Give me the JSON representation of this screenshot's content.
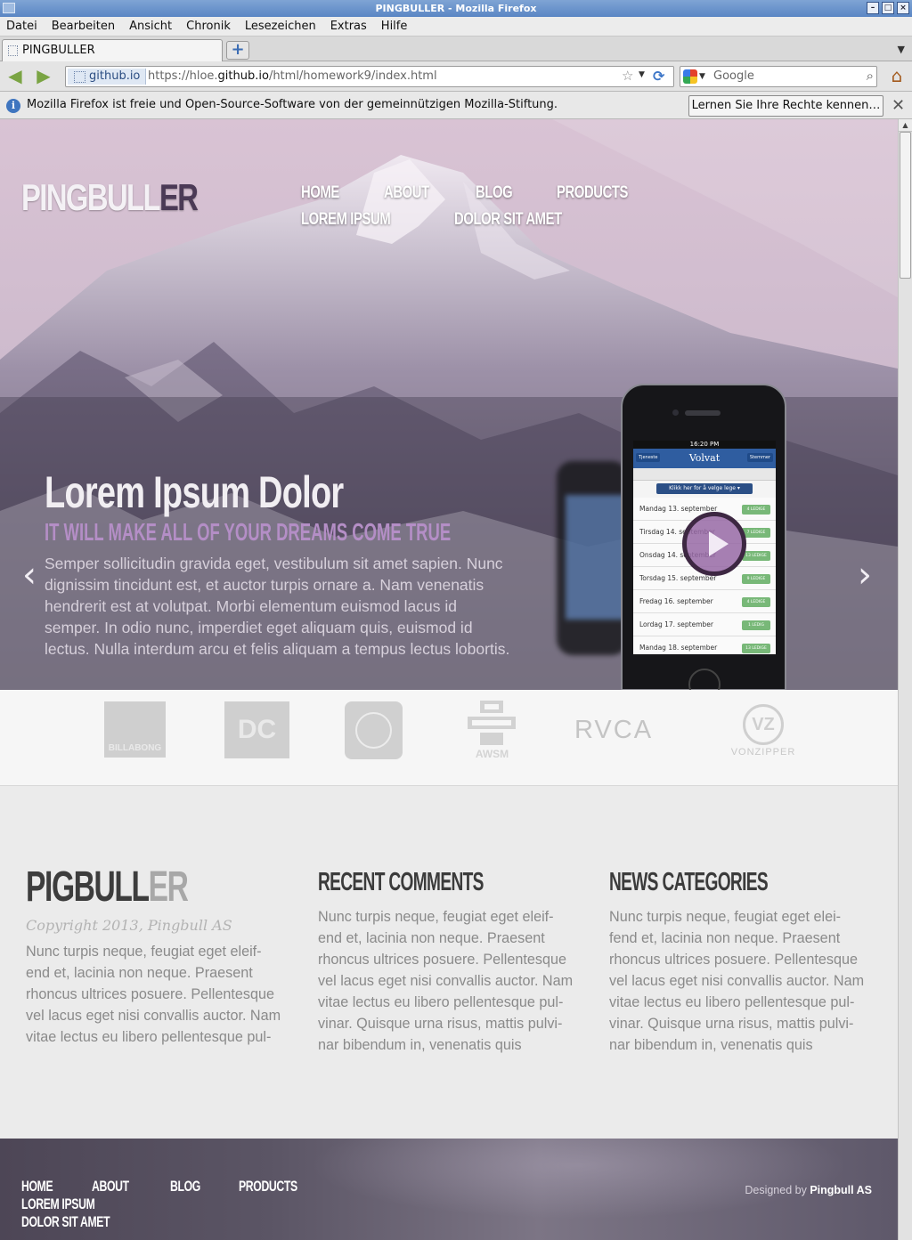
{
  "window": {
    "title": "PINGBULLER - Mozilla Firefox"
  },
  "menu": [
    "Datei",
    "Bearbeiten",
    "Ansicht",
    "Chronik",
    "Lesezeichen",
    "Extras",
    "Hilfe"
  ],
  "tab": {
    "label": "PINGBULLER"
  },
  "urlbar": {
    "identity": "github.io",
    "prefix": "https://hloe.",
    "domain": "github.io",
    "path": "/html/homework9/index.html"
  },
  "search": {
    "placeholder": "Google"
  },
  "notification": {
    "text": "Mozilla Firefox ist freie und Open-Source-Software von der gemeinnützigen Mozilla-Stiftung.",
    "button": "Lernen Sie Ihre Rechte kennen…"
  },
  "site": {
    "brand_light": "PINGBULL",
    "brand_dark": "ER",
    "nav": [
      "HOME",
      "ABOUT",
      "BLOG",
      "PRODUCTS",
      "LOREM IPSUM",
      "DOLOR SIT AMET"
    ],
    "slide": {
      "title": "Lorem Ipsum Dolor",
      "subtitle": "IT WILL MAKE ALL OF YOUR DREAMS COME TRUE",
      "text": "Semper sollicitudin gravida eget, vestibulum sit amet sapien. Nunc dignissim tincidunt est, et auctor turpis ornare a. Nam venenatis hendrerit est at volutpat. Morbi elementum euismod lacus id semper. In odio nunc, imperdiet eget aliquam quis, euismod id lectus. Nulla interdum arcu et felis aliquam a tempus lectus lobortis.",
      "prev": "‹",
      "next": "›"
    },
    "phone": {
      "time": "16:20 PM",
      "app": "Volvat",
      "left_btn": "Tjeneste",
      "right_btn": "Stemmer",
      "pick": "Klikk her for å velge lege ▾",
      "rows": [
        {
          "day": "Mandag 13. september",
          "badge": "4 LEDIGE"
        },
        {
          "day": "Tirsdag 14. september",
          "badge": "7 LEDIGE"
        },
        {
          "day": "Onsdag 14. september",
          "badge": "13 LEDIGE"
        },
        {
          "day": "Torsdag 15. september",
          "badge": "9 LEDIGE"
        },
        {
          "day": "Fredag 16. september",
          "badge": "4 LEDIGE"
        },
        {
          "day": "Lordag 17. september",
          "badge": "1 LEDIG"
        },
        {
          "day": "Mandag 18. september",
          "badge": "13 LEDIGE"
        }
      ]
    },
    "logos": [
      "BILLABONG",
      "DC",
      "ELEMENT",
      "AWSM",
      "RVCA",
      "VONZIPPER"
    ],
    "footer_brand_dark": "PIGBULL",
    "footer_brand_light": "ER",
    "copyright": "Copyright 2013, Pingbull AS",
    "about_text": "Nunc turpis neque, feugiat eget eleif- end et, lacinia non neque. Praesent rhoncus ultrices posuere. Pellentesque vel lacus eget nisi convallis auctor. Nam vitae lectus eu libero pellentesque pul-",
    "recent_heading": "RECENT COMMENTS",
    "recent_text": "Nunc turpis neque, feugiat eget eleif- end et, lacinia non neque. Praesent rhoncus ultrices posuere. Pellentesque vel lacus eget nisi convallis auctor. Nam vitae lectus eu libero pellentesque pul- vinar. Quisque urna risus, mattis pulvi- nar bibendum in, venenatis quis",
    "news_heading": "NEWS CATEGORIES",
    "news_text": "Nunc turpis neque, feugiat eget elei- fend et, lacinia non neque. Praesent rhoncus ultrices posuere. Pellentesque vel lacus eget nisi convallis auctor. Nam vitae lectus eu libero pellentesque pul- vinar. Quisque urna risus, mattis pulvi- nar bibendum in, venenatis quis",
    "footer_nav": [
      "HOME",
      "ABOUT",
      "BLOG",
      "PRODUCTS",
      "LOREM IPSUM",
      "DOLOR SIT AMET"
    ],
    "credit_prefix": "Designed by",
    "credit_name": "Pingbull AS"
  }
}
